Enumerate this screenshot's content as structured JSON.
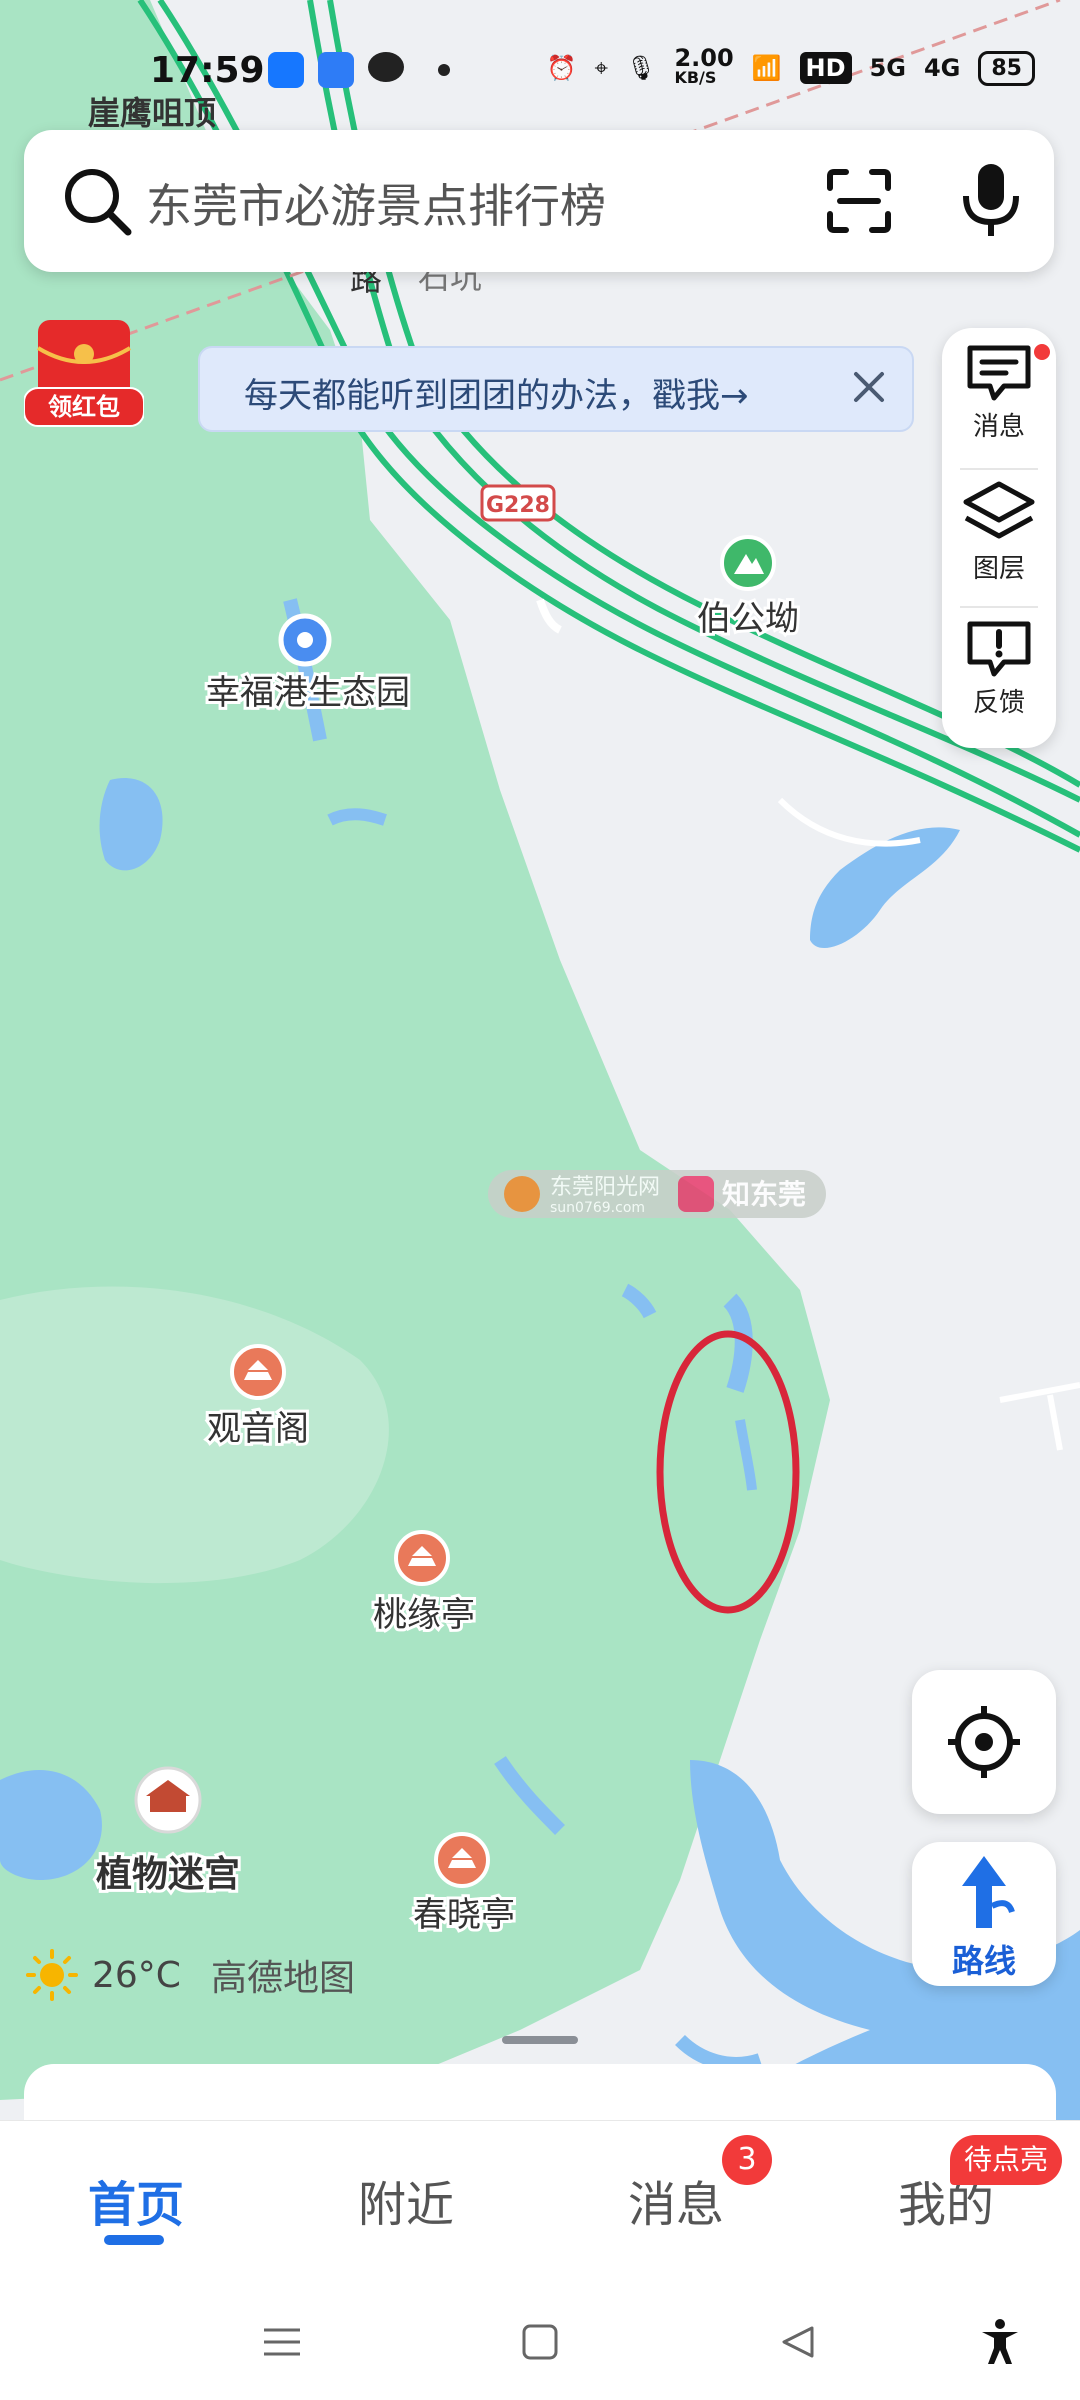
{
  "status_bar": {
    "time": "17:59",
    "net_speed_value": "2.00",
    "net_speed_unit": "KB/S",
    "hd_label": "HD",
    "sig1_label": "5G",
    "sig2_label": "4G",
    "battery": "85"
  },
  "search": {
    "placeholder": "东莞市必游景点排行榜"
  },
  "red_packet": {
    "label": "领红包"
  },
  "banner": {
    "text": "每天都能听到团团的办法，戳我→"
  },
  "side_panel": {
    "items": [
      {
        "label": "消息"
      },
      {
        "label": "图层"
      },
      {
        "label": "反馈"
      }
    ]
  },
  "map": {
    "road_label": "G228",
    "partial_top_label": "崖鹰咀顶",
    "partial_road": "路",
    "partial_place": "石坑",
    "pois": [
      {
        "name": "幸福港生态园",
        "icon": "pin-icon"
      },
      {
        "name": "伯公坳",
        "icon": "mountain-icon"
      },
      {
        "name": "观音阁",
        "icon": "temple-icon"
      },
      {
        "name": "桃缘亭",
        "icon": "pavilion-icon"
      },
      {
        "name": "植物迷宫",
        "icon": "building-icon"
      },
      {
        "name": "春晓亭",
        "icon": "pavilion-icon"
      }
    ],
    "watermark_left": "东莞阳光网",
    "watermark_left_sub": "sun0769.com",
    "watermark_right": "知东莞"
  },
  "weather": {
    "temp": "26°C",
    "brand": "高德地图"
  },
  "route_button": {
    "label": "路线"
  },
  "tabs": [
    {
      "label": "首页",
      "active": true
    },
    {
      "label": "附近",
      "active": false
    },
    {
      "label": "消息",
      "active": false,
      "badge": "3"
    },
    {
      "label": "我的",
      "active": false,
      "badge": "待点亮"
    }
  ],
  "colors": {
    "park_green": "#a9e4c4",
    "water_blue": "#86bff2",
    "road_green": "#27c07a",
    "accent_blue": "#1f6fe5",
    "badge_red": "#f23a3a",
    "annotation_red": "#d8263a"
  }
}
